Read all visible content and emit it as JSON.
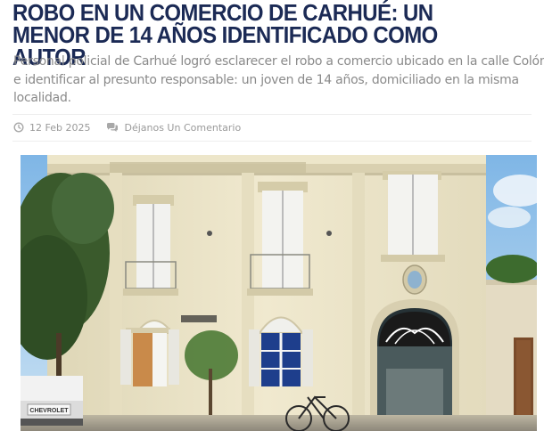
{
  "article": {
    "headline": "ROBO EN UN COMERCIO DE CARHUÉ: UN MENOR DE 14 AÑOS IDENTIFICADO COMO AUTOR",
    "lead": "Personal policial de Carhué logró esclarecer el robo a comercio ubicado en la calle Colón e identificar al presunto responsable: un joven de 14 años, domiciliado en la misma localidad.",
    "meta": {
      "date": "12 Feb 2025",
      "date_icon": "clock-icon",
      "comments_label": "Déjanos Un Comentario",
      "comments_icon": "comments-icon"
    },
    "image": {
      "subject": "police-station-building-photo",
      "truck_plate": "CHEVROLET"
    }
  },
  "colors": {
    "headline": "#1b2a55",
    "lead": "#8a8a8a",
    "meta": "#9a9a9a",
    "facade": "#ece4c8",
    "sky": "#8ec1ea"
  }
}
